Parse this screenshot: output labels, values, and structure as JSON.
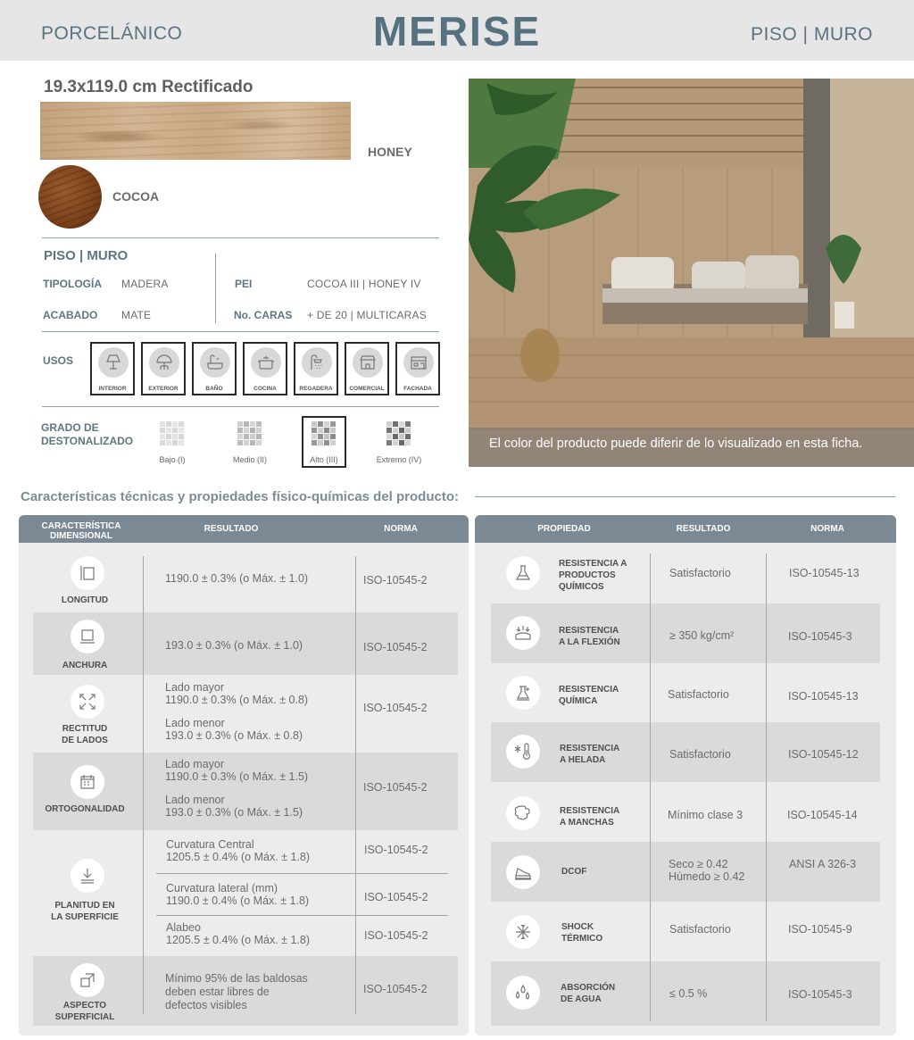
{
  "header": {
    "category": "PORCELÁNICO",
    "brand": "MERISE",
    "application": "PISO | MURO"
  },
  "product": {
    "size": "19.3x119.0 cm Rectificado",
    "colors": [
      "HONEY",
      "COCOA"
    ]
  },
  "specs": {
    "section_title": "PISO | MURO",
    "tipologia_label": "TIPOLOGÍA",
    "tipologia_value": "MADERA",
    "acabado_label": "ACABADO",
    "acabado_value": "MATE",
    "pei_label": "PEI",
    "pei_value": "COCOA III | HONEY IV",
    "caras_label": "No. CARAS",
    "caras_value": "+ DE 20 | MULTICARAS"
  },
  "usos": {
    "label": "USOS",
    "items": [
      "INTERIOR",
      "EXTERIOR",
      "BAÑO",
      "COCINA",
      "REGADERA",
      "COMERCIAL",
      "FACHADA"
    ]
  },
  "grado": {
    "label_line1": "GRADO DE",
    "label_line2": "DESTONALIZADO",
    "items": [
      "Bajo (I)",
      "Medio (II)",
      "Alto (III)",
      "Extremo (IV)"
    ],
    "selected": "Alto (III)"
  },
  "photo_caption": "El color del producto puede diferir de lo visualizado en esta ficha.",
  "characteristics_title": "Características técnicas y propiedades físico-químicas del producto:",
  "dimensional": {
    "headers": {
      "col1_line1": "CARACTERÍSTICA",
      "col1_line2": "DIMENSIONAL",
      "col2": "RESULTADO",
      "col3": "NORMA"
    },
    "rows": [
      {
        "label_line1": "LONGITUD",
        "label_line2": "",
        "result": [
          "1190.0 ± 0.3% (o Máx. ± 1.0)"
        ],
        "norm": "ISO-10545-2"
      },
      {
        "label_line1": "ANCHURA",
        "label_line2": "",
        "result": [
          "193.0 ± 0.3% (o Máx. ± 1.0)"
        ],
        "norm": "ISO-10545-2"
      },
      {
        "label_line1": "RECTITUD",
        "label_line2": "DE LADOS",
        "result": [
          "Lado mayor",
          "1190.0 ± 0.3% (o Máx. ± 0.8)",
          "Lado menor",
          "193.0 ± 0.3% (o Máx. ± 0.8)"
        ],
        "norm": "ISO-10545-2"
      },
      {
        "label_line1": "ORTOGONALIDAD",
        "label_line2": "",
        "result": [
          "Lado mayor",
          "1190.0 ± 0.3% (o Máx. ± 1.5)",
          "Lado menor",
          "193.0 ± 0.3% (o Máx. ± 1.5)"
        ],
        "norm": "ISO-10545-2"
      },
      {
        "label_line1": "PLANITUD EN",
        "label_line2": "LA SUPERFICIE",
        "sub": [
          {
            "result": [
              "Curvatura Central",
              "1205.5 ± 0.4% (o Máx. ± 1.8)"
            ],
            "norm": "ISO-10545-2"
          },
          {
            "result": [
              "Curvatura lateral (mm)",
              "1190.0 ± 0.4%  (o Máx. ± 1.8)"
            ],
            "norm": "ISO-10545-2"
          },
          {
            "result": [
              "Alabeo",
              "1205.5 ± 0.4% (o Máx. ± 1.8)"
            ],
            "norm": "ISO-10545-2"
          }
        ]
      },
      {
        "label_line1": "ASPECTO",
        "label_line2": "SUPERFICIAL",
        "result": [
          "Mínimo 95% de las baldosas",
          "deben estar libres de",
          "defectos visibles"
        ],
        "norm": "ISO-10545-2"
      }
    ]
  },
  "properties": {
    "headers": {
      "col1": "PROPIEDAD",
      "col2": "RESULTADO",
      "col3": "NORMA"
    },
    "rows": [
      {
        "label": [
          "RESISTENCIA A",
          "PRODUCTOS",
          "QUÍMICOS"
        ],
        "result": [
          "Satisfactorio"
        ],
        "norm": "ISO-10545-13",
        "icon": "flask-icon"
      },
      {
        "label": [
          "RESISTENCIA",
          "A LA FLEXIÓN"
        ],
        "result": [
          "≥ 350 kg/cm²"
        ],
        "norm": "ISO-10545-3",
        "icon": "flexion-icon"
      },
      {
        "label": [
          "RESISTENCIA",
          "QUÍMICA"
        ],
        "result": [
          "Satisfactorio"
        ],
        "norm": "ISO-10545-13",
        "icon": "chemistry-icon"
      },
      {
        "label": [
          "RESISTENCIA",
          "A HELADA"
        ],
        "result": [
          "Satisfactorio"
        ],
        "norm": "ISO-10545-12",
        "icon": "frost-thermometer-icon"
      },
      {
        "label": [
          "RESISTENCIA",
          "A MANCHAS"
        ],
        "result": [
          "Mínimo clase 3"
        ],
        "norm": "ISO-10545-14",
        "icon": "stain-icon"
      },
      {
        "label": [
          "DCOF"
        ],
        "result": [
          "Seco ≥ 0.42",
          "Húmedo ≥ 0.42"
        ],
        "norm": "ANSI A 326-3",
        "icon": "shoe-icon"
      },
      {
        "label": [
          "SHOCK",
          "TÉRMICO"
        ],
        "result": [
          "Satisfactorio"
        ],
        "norm": "ISO-10545-9",
        "icon": "thermal-shock-icon"
      },
      {
        "label": [
          "ABSORCIÓN",
          "DE AGUA"
        ],
        "result": [
          "≤ 0.5 %"
        ],
        "norm": "ISO-10545-3",
        "icon": "water-drops-icon"
      }
    ]
  }
}
